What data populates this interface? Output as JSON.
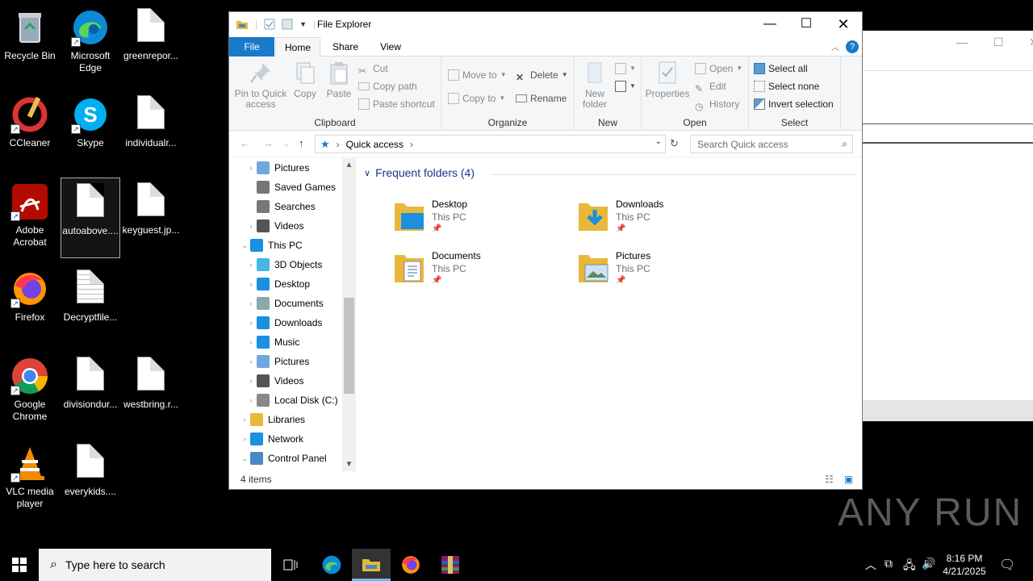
{
  "desktop": {
    "icons": [
      {
        "label": "Recycle Bin"
      },
      {
        "label": "Microsoft Edge"
      },
      {
        "label": "greenrepor..."
      },
      {
        "label": "CCleaner"
      },
      {
        "label": "Skype"
      },
      {
        "label": "individualr..."
      },
      {
        "label": "Adobe Acrobat"
      },
      {
        "label": "autoabove...."
      },
      {
        "label": "keyguest.jp..."
      },
      {
        "label": "Firefox"
      },
      {
        "label": "Decryptfile..."
      },
      {
        "label": "Google Chrome"
      },
      {
        "label": "divisiondur..."
      },
      {
        "label": "westbring.r..."
      },
      {
        "label": "VLC media player"
      },
      {
        "label": "everykids...."
      }
    ]
  },
  "explorer": {
    "title": "File Explorer",
    "tabs": {
      "file": "File",
      "home": "Home",
      "share": "Share",
      "view": "View"
    },
    "ribbon": {
      "clipboard": {
        "title": "Clipboard",
        "pin": "Pin to Quick access",
        "copy": "Copy",
        "paste": "Paste",
        "cut": "Cut",
        "copy_path": "Copy path",
        "paste_shortcut": "Paste shortcut"
      },
      "organize": {
        "title": "Organize",
        "move_to": "Move to",
        "copy_to": "Copy to",
        "delete": "Delete",
        "rename": "Rename"
      },
      "new": {
        "title": "New",
        "new_folder": "New folder"
      },
      "open": {
        "title": "Open",
        "properties": "Properties",
        "open": "Open",
        "edit": "Edit",
        "history": "History"
      },
      "select": {
        "title": "Select",
        "select_all": "Select all",
        "select_none": "Select none",
        "invert": "Invert selection"
      }
    },
    "address": {
      "location": "Quick access",
      "search_placeholder": "Search Quick access"
    },
    "nav": [
      {
        "label": "Pictures",
        "icon": "pictures-icon"
      },
      {
        "label": "Saved Games",
        "icon": "saved-games-icon"
      },
      {
        "label": "Searches",
        "icon": "search-icon"
      },
      {
        "label": "Videos",
        "icon": "videos-icon"
      },
      {
        "label": "This PC",
        "icon": "this-pc-icon"
      },
      {
        "label": "3D Objects",
        "icon": "3d-objects-icon"
      },
      {
        "label": "Desktop",
        "icon": "desktop-icon"
      },
      {
        "label": "Documents",
        "icon": "documents-icon"
      },
      {
        "label": "Downloads",
        "icon": "downloads-icon"
      },
      {
        "label": "Music",
        "icon": "music-icon"
      },
      {
        "label": "Pictures",
        "icon": "pictures-icon"
      },
      {
        "label": "Videos",
        "icon": "videos-icon"
      },
      {
        "label": "Local Disk (C:)",
        "icon": "disk-icon"
      },
      {
        "label": "Libraries",
        "icon": "libraries-icon"
      },
      {
        "label": "Network",
        "icon": "network-icon"
      },
      {
        "label": "Control Panel",
        "icon": "control-panel-icon"
      }
    ],
    "section_title": "Frequent folders (4)",
    "folders": [
      {
        "name": "Desktop",
        "location": "This PC"
      },
      {
        "name": "Downloads",
        "location": "This PC"
      },
      {
        "name": "Documents",
        "location": "This PC"
      },
      {
        "name": "Pictures",
        "location": "This PC"
      }
    ],
    "status": "4 items"
  },
  "taskbar": {
    "search_placeholder": "Type here to search",
    "time": "8:16 PM",
    "date": "4/21/2025"
  },
  "watermark": "ANY RUN",
  "colors": {
    "accent": "#1979ca",
    "ribbon_bg": "#f5f6f7",
    "section_text": "#1e3287"
  }
}
